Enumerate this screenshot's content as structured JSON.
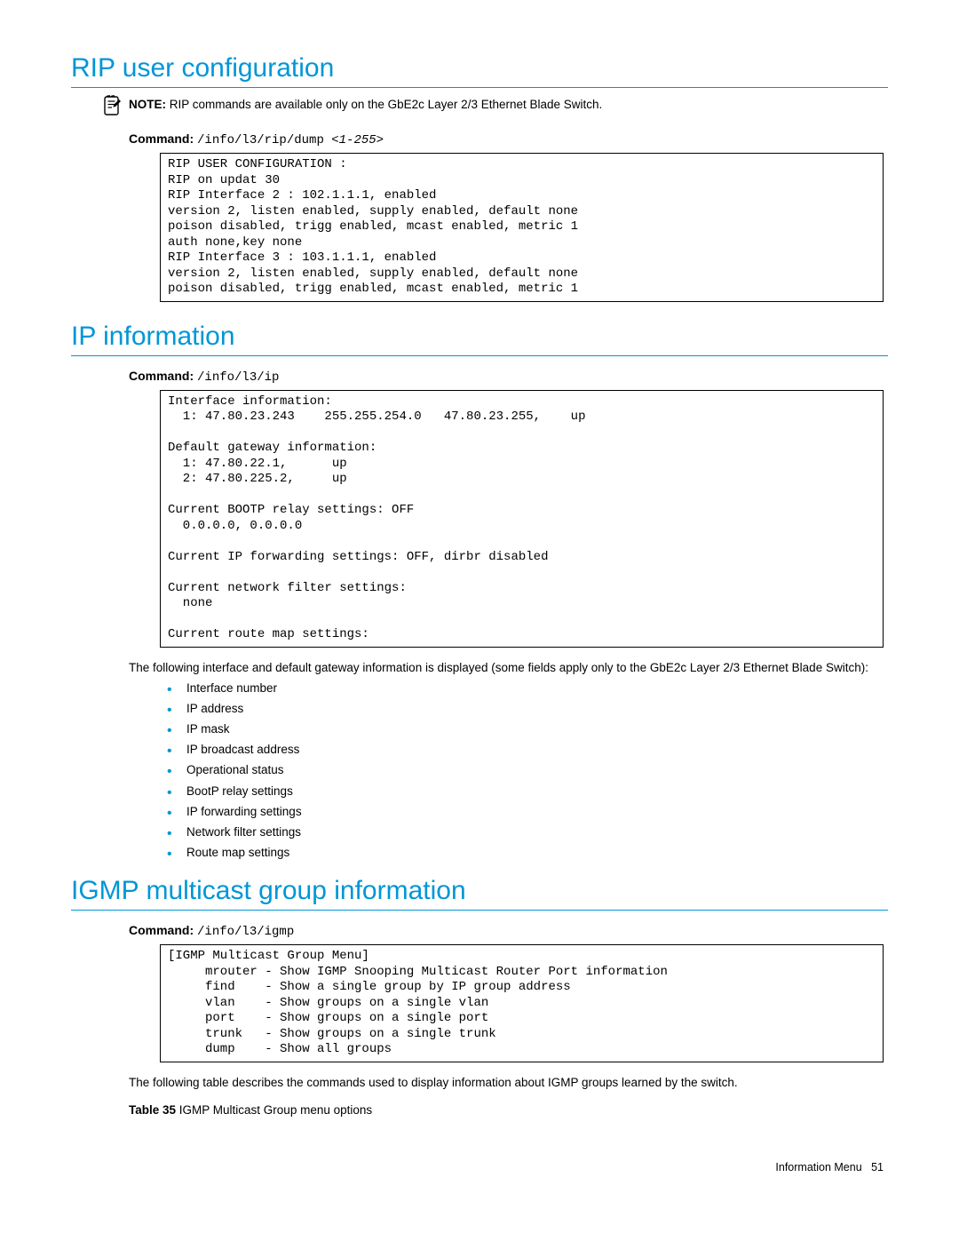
{
  "section1": {
    "heading": "RIP user configuration",
    "note_label": "NOTE:",
    "note_text": " RIP commands are available only on the GbE2c Layer 2/3 Ethernet Blade Switch.",
    "command_label": "Command:",
    "command_code": "/info/l3/rip/dump ",
    "command_arg": "<1-255>",
    "code_box": "RIP USER CONFIGURATION :\nRIP on updat 30\nRIP Interface 2 : 102.1.1.1, enabled\nversion 2, listen enabled, supply enabled, default none\npoison disabled, trigg enabled, mcast enabled, metric 1\nauth none,key none\nRIP Interface 3 : 103.1.1.1, enabled\nversion 2, listen enabled, supply enabled, default none\npoison disabled, trigg enabled, mcast enabled, metric 1"
  },
  "section2": {
    "heading": "IP information",
    "command_label": "Command:",
    "command_code": "/info/l3/ip",
    "code_box": "Interface information:\n  1: 47.80.23.243    255.255.254.0   47.80.23.255,    up\n\nDefault gateway information:\n  1: 47.80.22.1,      up\n  2: 47.80.225.2,     up\n\nCurrent BOOTP relay settings: OFF\n  0.0.0.0, 0.0.0.0\n\nCurrent IP forwarding settings: OFF, dirbr disabled\n\nCurrent network filter settings:\n  none\n\nCurrent route map settings:",
    "para": "The following interface and default gateway information is displayed (some fields apply only to the GbE2c Layer 2/3 Ethernet Blade Switch):",
    "bullets": [
      "Interface number",
      "IP address",
      "IP mask",
      "IP broadcast address",
      "Operational status",
      "BootP relay settings",
      "IP forwarding settings",
      "Network filter settings",
      "Route map settings"
    ]
  },
  "section3": {
    "heading": "IGMP multicast group information",
    "command_label": "Command:",
    "command_code": "/info/l3/igmp",
    "code_box": "[IGMP Multicast Group Menu]\n     mrouter - Show IGMP Snooping Multicast Router Port information\n     find    - Show a single group by IP group address\n     vlan    - Show groups on a single vlan\n     port    - Show groups on a single port\n     trunk   - Show groups on a single trunk\n     dump    - Show all groups",
    "para": "The following table describes the commands used to display information about IGMP groups learned by the switch.",
    "table_label": "Table 35",
    "table_caption": " IGMP Multicast Group menu options"
  },
  "footer": {
    "section_name": "Information Menu",
    "page_number": "51"
  }
}
